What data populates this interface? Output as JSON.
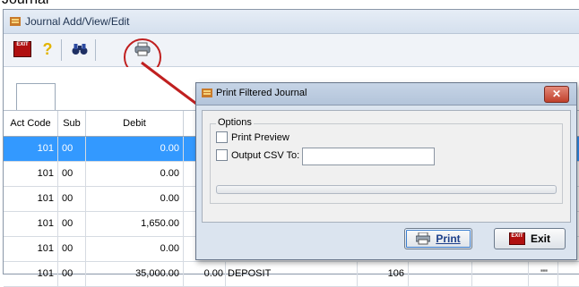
{
  "partial_heading": "Journal",
  "window": {
    "title": "Journal Add/View/Edit"
  },
  "toolbar": {
    "exit_icon_text": "EXIT"
  },
  "grid": {
    "headers": [
      "Act Code",
      "Sub",
      "Debit",
      ""
    ],
    "rows": [
      {
        "act": "101",
        "sub": "00",
        "debit": "0.00",
        "selected": true
      },
      {
        "act": "101",
        "sub": "00",
        "debit": "0.00"
      },
      {
        "act": "101",
        "sub": "00",
        "debit": "0.00"
      },
      {
        "act": "101",
        "sub": "00",
        "debit": "1,650.00"
      },
      {
        "act": "101",
        "sub": "00",
        "debit": "0.00"
      },
      {
        "act": "101",
        "sub": "00",
        "debit": "35,000.00",
        "credit": "0.00",
        "desc": "DEPOSIT",
        "ref": "106",
        "extra": "\"\""
      }
    ]
  },
  "dialog": {
    "title": "Print Filtered Journal",
    "close_label": "✕",
    "group_title": "Options",
    "print_preview_label": "Print Preview",
    "output_csv_label": "Output CSV To:",
    "csv_value": "",
    "print_button": "Print",
    "exit_button": "Exit",
    "exit_icon_text": "EXIT"
  },
  "colors": {
    "selection": "#3399ff",
    "annotation": "#c02020"
  }
}
